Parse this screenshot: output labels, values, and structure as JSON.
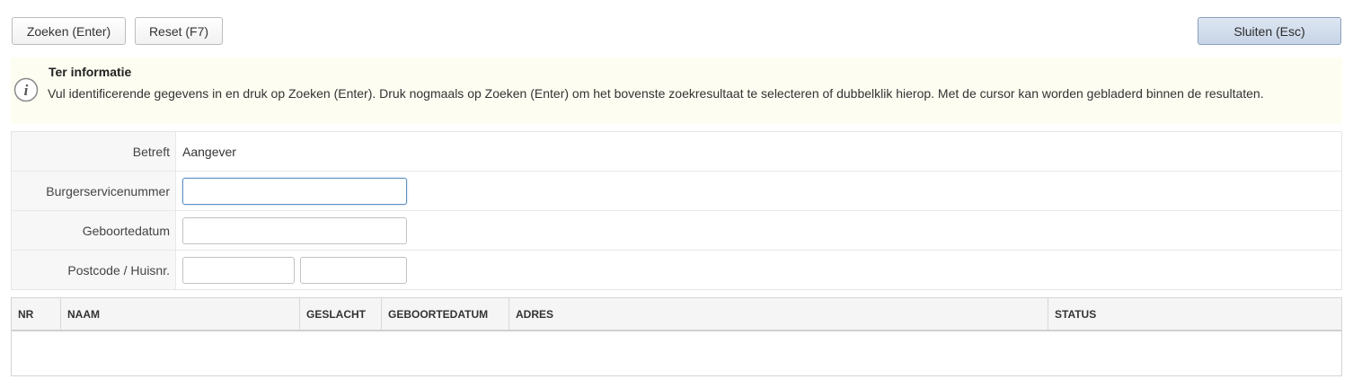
{
  "toolbar": {
    "search_label": "Zoeken (Enter)",
    "reset_label": "Reset (F7)",
    "close_label": "Sluiten (Esc)"
  },
  "info": {
    "icon": "info-icon",
    "title": "Ter informatie",
    "text": "Vul identificerende gegevens in en druk op Zoeken (Enter). Druk nogmaals op Zoeken (Enter) om het bovenste zoekresultaat te selecteren of dubbelklik hierop. Met de cursor kan worden gebladerd binnen de resultaten."
  },
  "form": {
    "betreft_label": "Betreft",
    "betreft_value": "Aangever",
    "bsn_label": "Burgerservicenummer",
    "bsn_value": "",
    "geboortedatum_label": "Geboortedatum",
    "geboortedatum_value": "",
    "postcode_label": "Postcode / Huisnr.",
    "postcode_value": "",
    "huisnr_value": ""
  },
  "grid": {
    "columns": [
      "NR",
      "NAAM",
      "GESLACHT",
      "GEBOORTEDATUM",
      "ADRES",
      "STATUS"
    ],
    "rows": []
  },
  "colors": {
    "info_background": "#fdfdf1",
    "close_button": "#c7d4e6",
    "focus_border": "#5b8fc2"
  }
}
